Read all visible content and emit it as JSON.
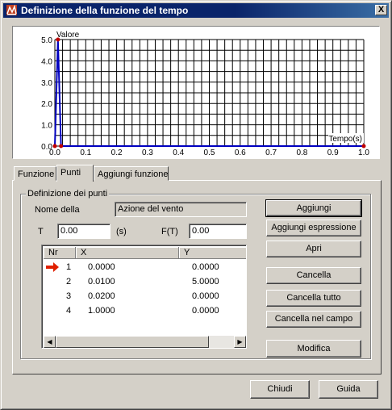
{
  "window": {
    "title": "Definizione della funzione del tempo",
    "close_label": "X"
  },
  "chart_data": {
    "type": "line",
    "xlabel": "Tempo(s)",
    "ylabel": "Valore",
    "xlim": [
      0,
      1
    ],
    "ylim": [
      0,
      5
    ],
    "x_ticks": [
      "0.0",
      "0.1",
      "0.2",
      "0.3",
      "0.4",
      "0.5",
      "0.6",
      "0.7",
      "0.8",
      "0.9",
      "1.0"
    ],
    "y_ticks": [
      "0.0",
      "1.0",
      "2.0",
      "3.0",
      "4.0",
      "5.0"
    ],
    "grid": true,
    "series": [
      {
        "x": [
          0.0,
          0.01,
          0.02,
          1.0
        ],
        "y": [
          0.0,
          5.0,
          0.0,
          0.0
        ]
      }
    ],
    "colors": {
      "line": "#0000c0",
      "points": "#c00000",
      "grid": "#000000"
    }
  },
  "tabs": [
    {
      "label": "Funzione"
    },
    {
      "label": "Punti"
    },
    {
      "label": "Aggiungi funzione"
    }
  ],
  "group": {
    "title": "Definizione dei punti"
  },
  "form": {
    "name_label": "Nome della",
    "name_value": "Azione del vento",
    "t_label": "T",
    "t_value": "0.00",
    "t_unit": "(s)",
    "ft_label": "F(T)",
    "ft_value": "0.00"
  },
  "table": {
    "columns": [
      "Nr",
      "X",
      "Y"
    ],
    "rows": [
      {
        "nr": "1",
        "x": "0.0000",
        "y": "0.0000"
      },
      {
        "nr": "2",
        "x": "0.0100",
        "y": "5.0000"
      },
      {
        "nr": "3",
        "x": "0.0200",
        "y": "0.0000"
      },
      {
        "nr": "4",
        "x": "1.0000",
        "y": "0.0000"
      }
    ],
    "current_row": 1
  },
  "buttons": {
    "aggiungi": "Aggiungi",
    "aggiungi_espressione": "Aggiungi espressione",
    "apri": "Apri",
    "cancella": "Cancella",
    "cancella_tutto": "Cancella tutto",
    "cancella_campo": "Cancella nel campo",
    "modifica": "Modifica",
    "chiudi": "Chiudi",
    "guida": "Guida"
  }
}
